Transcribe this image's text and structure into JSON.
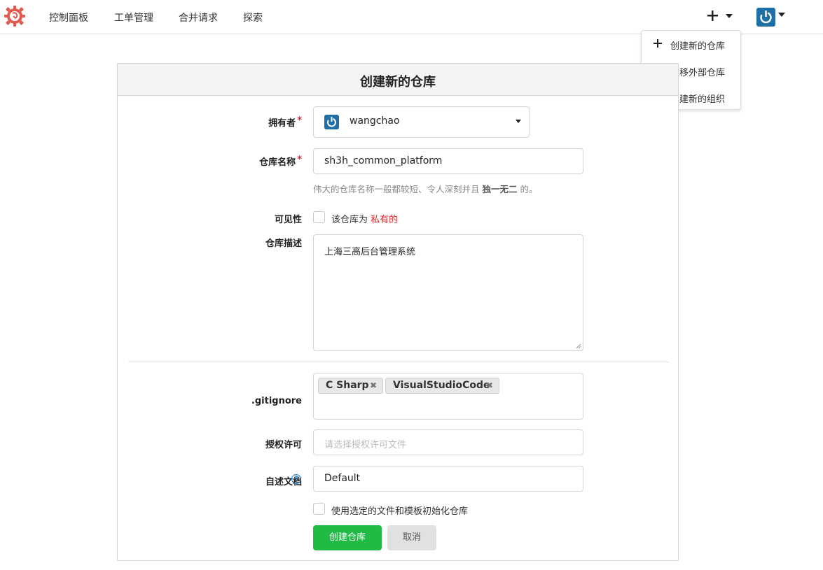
{
  "nav": {
    "logo_icon": "gitea-gear-logo-icon",
    "items": [
      "控制面板",
      "工单管理",
      "合并请求",
      "探索"
    ],
    "plus_icon": "plus-icon",
    "avatar_icon": "power-avatar-icon"
  },
  "dropdown": {
    "items": [
      {
        "label": "创建新的仓库",
        "icon": "plus-icon"
      },
      {
        "label": "迁移外部仓库",
        "icon": "migrate-icon"
      },
      {
        "label": "创建新的组织",
        "icon": "people-icon"
      }
    ]
  },
  "form": {
    "title": "创建新的仓库",
    "owner": {
      "label": "拥有者",
      "required": "*",
      "value": "wangchao"
    },
    "repo_name": {
      "label": "仓库名称",
      "required": "*",
      "value": "sh3h_common_platform",
      "help_prefix": "伟大的仓库名称一般都较短、令人深刻并且",
      "help_emphasis": "独一无二",
      "help_suffix": "的。"
    },
    "visibility": {
      "label": "可见性",
      "text_prefix": "该仓库为",
      "text_private": "私有的",
      "checked": false
    },
    "description": {
      "label": "仓库描述",
      "value": "上海三高后台管理系统"
    },
    "gitignore": {
      "label": ".gitignore",
      "tags": [
        "C Sharp",
        "VisualStudioCode"
      ]
    },
    "license": {
      "label": "授权许可",
      "placeholder": "请选择授权许可文件"
    },
    "readme": {
      "label": "自述文档",
      "value": "Default",
      "help_icon": "question-circle-icon"
    },
    "auto_init": {
      "text": "使用选定的文件和模板初始化仓库",
      "checked": false
    },
    "buttons": {
      "create": "创建仓库",
      "cancel": "取消"
    },
    "colors": {
      "primary": "#21ba45",
      "required": "#db2828",
      "avatar": "#1e6fa5",
      "logo": "#e05a4f"
    }
  }
}
